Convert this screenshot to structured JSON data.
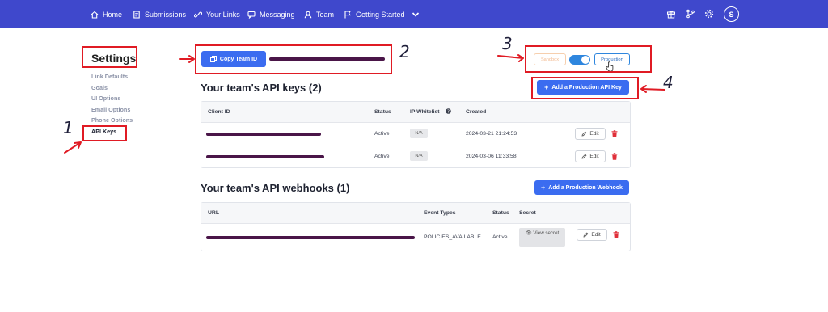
{
  "nav": {
    "items": [
      {
        "label": "Home",
        "icon": "home-icon"
      },
      {
        "label": "Submissions",
        "icon": "document-icon"
      },
      {
        "label": "Your Links",
        "icon": "link-icon"
      },
      {
        "label": "Messaging",
        "icon": "chat-icon"
      },
      {
        "label": "Team",
        "icon": "team-icon"
      },
      {
        "label": "Getting Started",
        "icon": "flag-icon"
      }
    ],
    "avatar_initial": "S",
    "right_icons": [
      "gift-icon",
      "branch-icon",
      "settings-gear-icon"
    ]
  },
  "settings": {
    "title": "Settings",
    "menu": [
      "Link Defaults",
      "Goals",
      "UI Options",
      "Email Options",
      "Phone Options",
      "API Keys"
    ],
    "active": "API Keys"
  },
  "copy_team_id_label": "Copy Team ID",
  "env_toggle": {
    "sandbox_label": "Sandbox",
    "production_label": "Production"
  },
  "api_keys": {
    "title": "Your team's API keys (2)",
    "add_button_label": "Add a Production API Key",
    "columns": [
      "Client ID",
      "Status",
      "IP Whitelist",
      "Created"
    ],
    "rows": [
      {
        "status": "Active",
        "ip_whitelist": "N/A",
        "created": "2024-03-21 21:24:53"
      },
      {
        "status": "Active",
        "ip_whitelist": "N/A",
        "created": "2024-03-06 11:33:58"
      }
    ]
  },
  "webhooks": {
    "title": "Your team's API webhooks (1)",
    "add_button_label": "Add a Production Webhook",
    "columns": [
      "URL",
      "Event Types",
      "Status",
      "Secret"
    ],
    "rows": [
      {
        "event_types": "POLICIES_AVAILABLE",
        "status": "Active",
        "secret_label": "View secret"
      }
    ]
  },
  "edit_label": "Edit",
  "annotations": [
    "1",
    "2",
    "3",
    "4"
  ],
  "colors": {
    "nav_bg": "#3f48cc",
    "primary": "#3b6cf0",
    "annotation": "#e01b24",
    "delete": "#e0303a"
  }
}
